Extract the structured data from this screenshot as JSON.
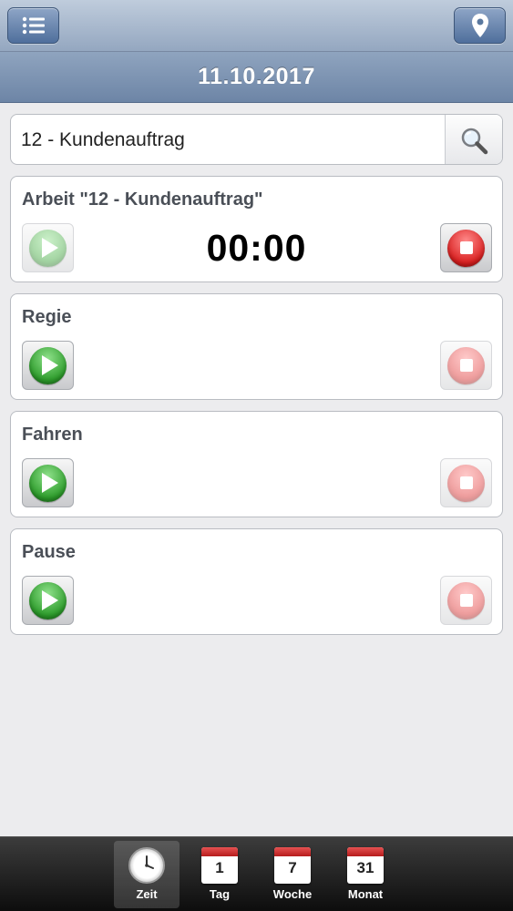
{
  "header": {
    "menu_icon": "list-icon",
    "location_icon": "map-pin-icon",
    "date": "11.10.2017"
  },
  "search": {
    "value": "12 - Kundenauftrag",
    "icon": "search-icon"
  },
  "cards": [
    {
      "title": "Arbeit \"12 - Kundenauftrag\"",
      "timer": "00:00",
      "play_enabled": false,
      "stop_enabled": true
    },
    {
      "title": "Regie",
      "timer": "",
      "play_enabled": true,
      "stop_enabled": false
    },
    {
      "title": "Fahren",
      "timer": "",
      "play_enabled": true,
      "stop_enabled": false
    },
    {
      "title": "Pause",
      "timer": "",
      "play_enabled": true,
      "stop_enabled": false
    }
  ],
  "tabs": [
    {
      "label": "Zeit",
      "icon": "clock-icon",
      "active": true
    },
    {
      "label": "Tag",
      "icon": "calendar-icon",
      "day": "1",
      "active": false
    },
    {
      "label": "Woche",
      "icon": "calendar-icon",
      "day": "7",
      "active": false
    },
    {
      "label": "Monat",
      "icon": "calendar-icon",
      "day": "31",
      "active": false
    }
  ],
  "colors": {
    "header_blue": "#6d85a6",
    "play_green": "#2c9b2a",
    "stop_red": "#d91f1f"
  }
}
